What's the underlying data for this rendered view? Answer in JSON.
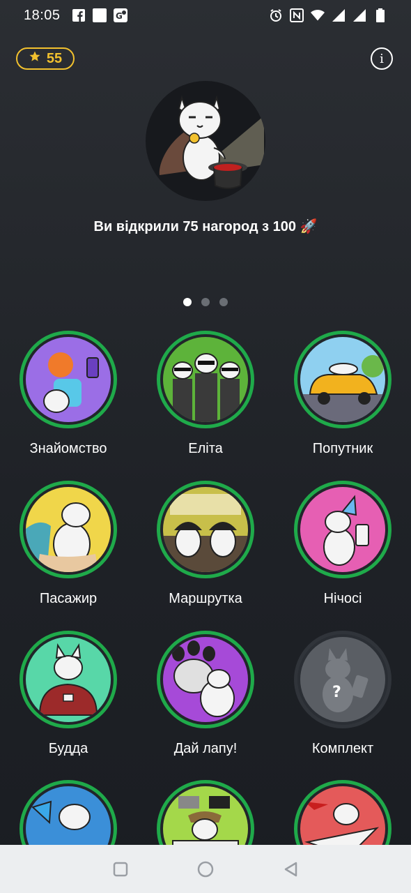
{
  "status_bar": {
    "time": "18:05",
    "left_icons": [
      "facebook-icon",
      "square-notification-icon",
      "map-icon"
    ],
    "right_icons": [
      "alarm-icon",
      "nfc-icon",
      "wifi-icon",
      "signal-icon",
      "signal-icon",
      "battery-icon"
    ]
  },
  "points": {
    "value": "55",
    "icon": "star-icon",
    "color": "#f2c12e"
  },
  "info_icon": "info-icon",
  "hero": {
    "text": "Ви відкрили 75 нагород з 100 🚀"
  },
  "pager": {
    "count": 3,
    "active": 0
  },
  "awards": [
    {
      "label": "Знайомство",
      "locked": false,
      "bg": "#9b6ee6"
    },
    {
      "label": "Еліта",
      "locked": false,
      "bg": "#5db33a"
    },
    {
      "label": "Попутник",
      "locked": false,
      "bg": "#8fd0f0"
    },
    {
      "label": "Пасажир",
      "locked": false,
      "bg": "#f0d64a"
    },
    {
      "label": "Маршрутка",
      "locked": false,
      "bg": "#c8bf4a"
    },
    {
      "label": "Нічосі",
      "locked": false,
      "bg": "#e65fb3"
    },
    {
      "label": "Будда",
      "locked": false,
      "bg": "#58d7a8"
    },
    {
      "label": "Дай лапу!",
      "locked": false,
      "bg": "#a64ad8"
    },
    {
      "label": "Комплект",
      "locked": true,
      "bg": "#5a5e64"
    },
    {
      "label": "",
      "locked": false,
      "bg": "#3b8fd8"
    },
    {
      "label": "",
      "locked": false,
      "bg": "#a4d84a"
    },
    {
      "label": "",
      "locked": false,
      "bg": "#e45a5a"
    }
  ],
  "accent_colors": {
    "earned_ring": "#1faa4a",
    "locked_ring": "#30343a"
  }
}
